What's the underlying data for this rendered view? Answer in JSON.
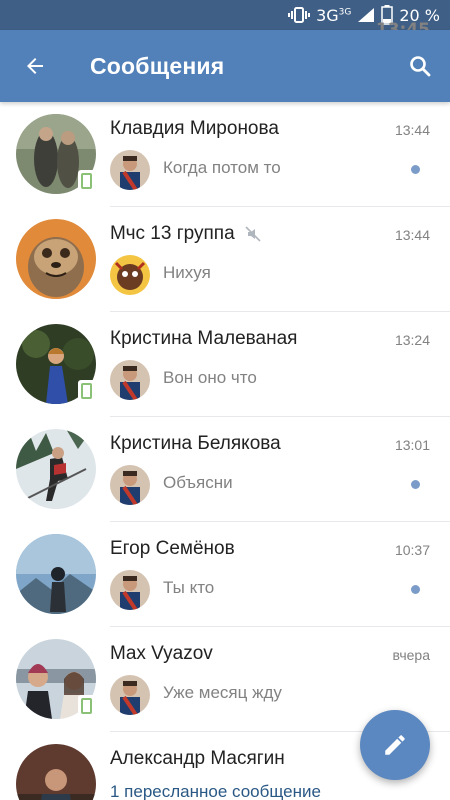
{
  "status_bar": {
    "network": "3G",
    "network_sup": "3G",
    "battery": "20 %",
    "time": "13:45"
  },
  "header": {
    "title": "Сообщения",
    "back_icon": "arrow-back-icon",
    "search_icon": "search-icon"
  },
  "colors": {
    "header": "#5181b8",
    "status_bar": "#3f5f86",
    "unread_dot": "#7b9cc9",
    "link": "#2a5885",
    "online": "#8ac176"
  },
  "conversations": [
    {
      "name": "Клавдия Миронова",
      "time": "13:44",
      "preview": "Когда потом то",
      "unread": true,
      "online_mobile": true,
      "muted": false
    },
    {
      "name": "Мчс 13 группа",
      "time": "13:44",
      "preview": "Нихуя",
      "unread": false,
      "online_mobile": false,
      "muted": true
    },
    {
      "name": "Кристина Малеваная",
      "time": "13:24",
      "preview": "Вон оно что",
      "unread": false,
      "online_mobile": true,
      "muted": false
    },
    {
      "name": "Кристина Белякова",
      "time": "13:01",
      "preview": "Объясни",
      "unread": true,
      "online_mobile": false,
      "muted": false
    },
    {
      "name": "Егор Семёнов",
      "time": "10:37",
      "preview": "Ты кто",
      "unread": true,
      "online_mobile": false,
      "muted": false
    },
    {
      "name": "Max Vyazov",
      "time": "вчера",
      "preview": "Уже месяц жду",
      "unread": false,
      "online_mobile": true,
      "muted": false
    },
    {
      "name": "Александр Масягин",
      "time": "",
      "preview": "1 пересланное сообщение",
      "unread": false,
      "online_mobile": false,
      "muted": false
    }
  ],
  "fab": {
    "icon": "pencil-icon"
  }
}
